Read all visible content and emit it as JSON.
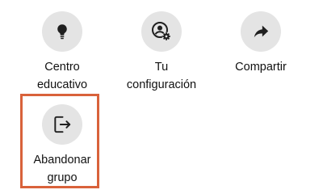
{
  "colors": {
    "icon_circle_bg": "#e4e4e4",
    "icon": "#1f1f1f",
    "label_text": "#111111",
    "highlight_border": "#d9623b"
  },
  "actions": [
    {
      "icon": "lightbulb-icon",
      "label": "Centro\neducativo"
    },
    {
      "icon": "account-settings-icon",
      "label": "Tu\nconfiguración"
    },
    {
      "icon": "share-arrow-icon",
      "label": "Compartir"
    },
    {
      "icon": "leave-group-icon",
      "label": "Abandonar\ngrupo",
      "highlighted": true
    }
  ]
}
